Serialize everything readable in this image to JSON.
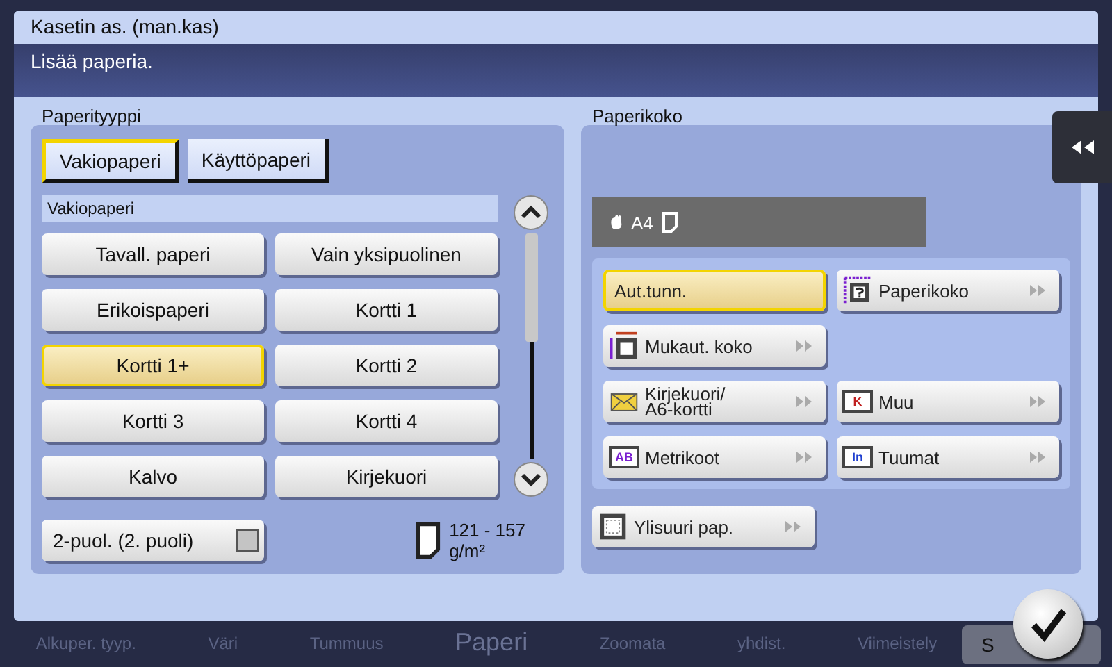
{
  "dialog": {
    "title": "Kasetin as. (man.kas)",
    "message": "Lisää paperia."
  },
  "paper_type": {
    "heading": "Paperityyppi",
    "tabs": [
      {
        "label": "Vakiopaperi",
        "selected": true
      },
      {
        "label": "Käyttöpaperi",
        "selected": false
      }
    ],
    "list_heading": "Vakiopaperi",
    "options": [
      {
        "label": "Tavall. paperi",
        "selected": false
      },
      {
        "label": "Vain yksipuolinen",
        "selected": false
      },
      {
        "label": "Erikoispaperi",
        "selected": false
      },
      {
        "label": "Kortti 1",
        "selected": false
      },
      {
        "label": "Kortti 1+",
        "selected": true
      },
      {
        "label": "Kortti 2",
        "selected": false
      },
      {
        "label": "Kortti 3",
        "selected": false
      },
      {
        "label": "Kortti 4",
        "selected": false
      },
      {
        "label": "Kalvo",
        "selected": false
      },
      {
        "label": "Kirjekuori",
        "selected": false
      }
    ],
    "duplex": {
      "label": "2-puol. (2. puoli)",
      "checked": false
    },
    "weight": {
      "range": "121 - 157",
      "unit": "g/m²"
    }
  },
  "paper_size": {
    "heading": "Paperikoko",
    "current": "A4",
    "rows": [
      [
        {
          "label": "Aut.tunn.",
          "kind": "plain",
          "selected": true
        },
        {
          "label": "Paperikoko",
          "kind": "question",
          "selected": false
        }
      ],
      [
        {
          "label": "Mukaut. koko",
          "kind": "custom",
          "selected": false
        }
      ],
      [
        {
          "label": "Kirjekuori/\nA6-kortti",
          "kind": "envelope",
          "selected": false
        },
        {
          "label": "Muu",
          "kind": "badge",
          "badge": "K",
          "color": "#c02020",
          "selected": false
        }
      ],
      [
        {
          "label": "Metrikoot",
          "kind": "badge",
          "badge": "AB",
          "color": "#7a1fd0",
          "selected": false
        },
        {
          "label": "Tuumat",
          "kind": "badge",
          "badge": "In",
          "color": "#2040d0",
          "selected": false
        }
      ]
    ],
    "oversize": {
      "label": "Ylisuuri pap.",
      "kind": "oversize",
      "selected": false
    }
  },
  "background_tabs": [
    {
      "label": "Alkuper. tyyp.",
      "selected": false
    },
    {
      "label": "Väri",
      "selected": false
    },
    {
      "label": "Tummuus",
      "selected": false
    },
    {
      "label": "Paperi",
      "selected": true
    },
    {
      "label": "Zoomata",
      "selected": false
    },
    {
      "label": "yhdist.",
      "selected": false
    },
    {
      "label": "Viimeistely",
      "selected": false
    }
  ],
  "background_button": "S"
}
